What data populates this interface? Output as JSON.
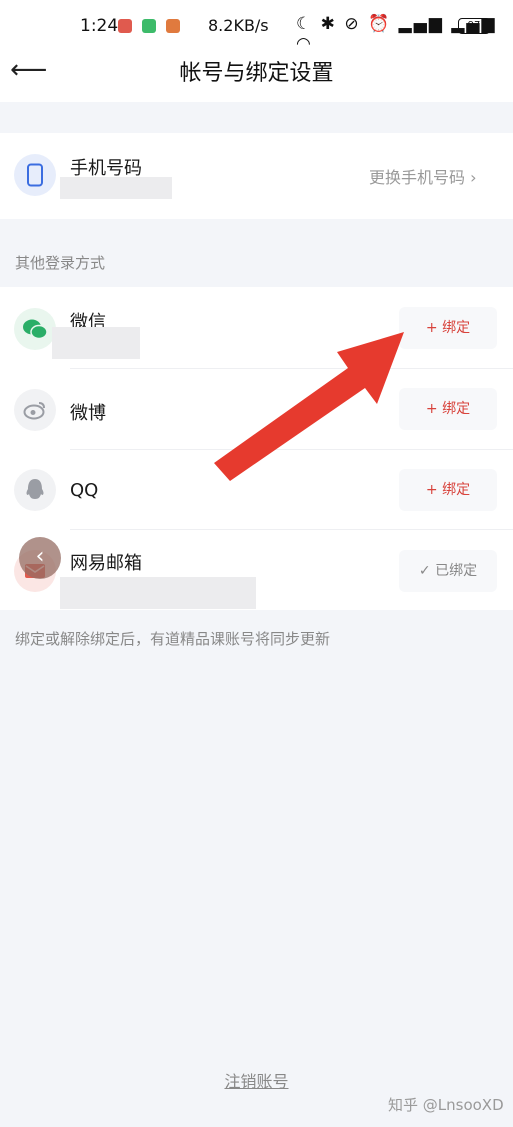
{
  "status": {
    "time": "1:24",
    "net_speed": "8.2KB/s",
    "icons": [
      "moon-icon",
      "bluetooth-icon",
      "mute-icon",
      "alarm-icon",
      "signal-icon",
      "signal-icon",
      "wifi-icon"
    ],
    "battery": "97"
  },
  "header": {
    "title": "帐号与绑定设置",
    "back_icon": "arrow-left-icon"
  },
  "phone": {
    "label": "手机号码",
    "action": "更换手机号码 ›"
  },
  "section_label": "其他登录方式",
  "accounts": [
    {
      "label": "微信",
      "button": "+ 绑定",
      "icon": "wechat-icon"
    },
    {
      "label": "微博",
      "button": "+ 绑定",
      "icon": "weibo-icon"
    },
    {
      "label": "QQ",
      "button": "+ 绑定",
      "icon": "qq-icon"
    },
    {
      "label": "网易邮箱",
      "button": "✓ 已绑定",
      "icon": "netease-mail-icon"
    }
  ],
  "note": "绑定或解除绑定后，有道精品课账号将同步更新",
  "cancel_account": "注销账号",
  "watermark": "知乎 @LnsooXD",
  "colors": {
    "accent_red": "#d8433c",
    "arrow": "#e63a2e",
    "wechat": "#2aae67"
  }
}
